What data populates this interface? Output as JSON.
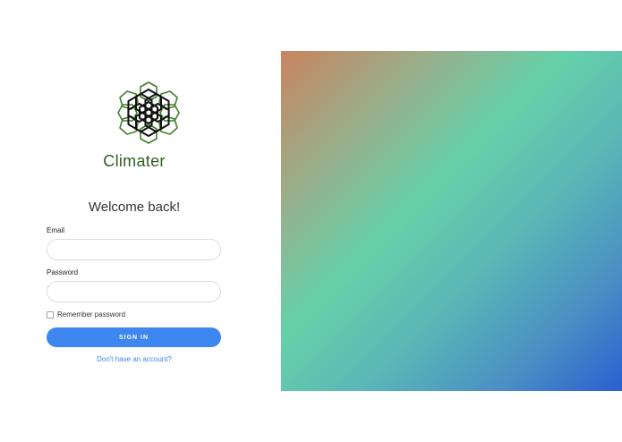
{
  "brand": {
    "name": "Climater",
    "logo_icon": "hexagon-flower-logo"
  },
  "login": {
    "heading": "Welcome back!",
    "email_label": "Email",
    "email_value": "",
    "email_placeholder": "",
    "password_label": "Password",
    "password_value": "",
    "password_placeholder": "",
    "remember_label": "Remember password",
    "remember_checked": false,
    "signin_label": "SIGN IN",
    "signup_link": "Don't have an account?"
  },
  "colors": {
    "brand_text": "#2f5e1f",
    "accent": "#3e86f0",
    "gradient": [
      "#c98460",
      "#66d1a9",
      "#2a5fd0"
    ]
  }
}
